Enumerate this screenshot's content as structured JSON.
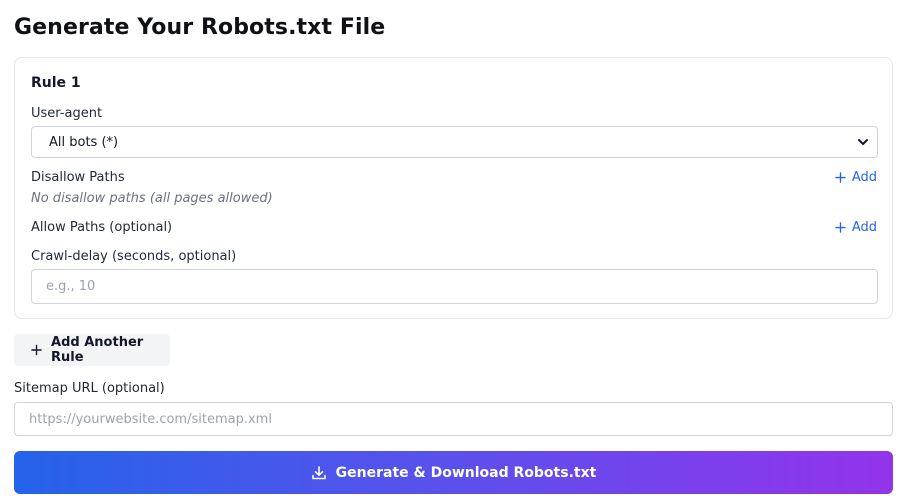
{
  "page": {
    "title": "Generate Your Robots.txt File"
  },
  "rule": {
    "title": "Rule 1",
    "user_agent_label": "User-agent",
    "user_agent_value": "All bots (*)",
    "disallow_label": "Disallow Paths",
    "disallow_add": "Add",
    "disallow_empty": "No disallow paths (all pages allowed)",
    "allow_label": "Allow Paths (optional)",
    "allow_add": "Add",
    "crawl_label": "Crawl-delay (seconds, optional)",
    "crawl_placeholder": "e.g., 10"
  },
  "actions": {
    "add_rule": "Add Another Rule",
    "generate": "Generate & Download Robots.txt"
  },
  "sitemap": {
    "label": "Sitemap URL (optional)",
    "placeholder": "https://yourwebsite.com/sitemap.xml"
  },
  "icons": {
    "add": "plus-icon",
    "select": "chevron-down-icon",
    "download": "download-icon"
  },
  "colors": {
    "accent": "#2563eb",
    "gradient_start": "#2563eb",
    "gradient_end": "#9333ea"
  }
}
